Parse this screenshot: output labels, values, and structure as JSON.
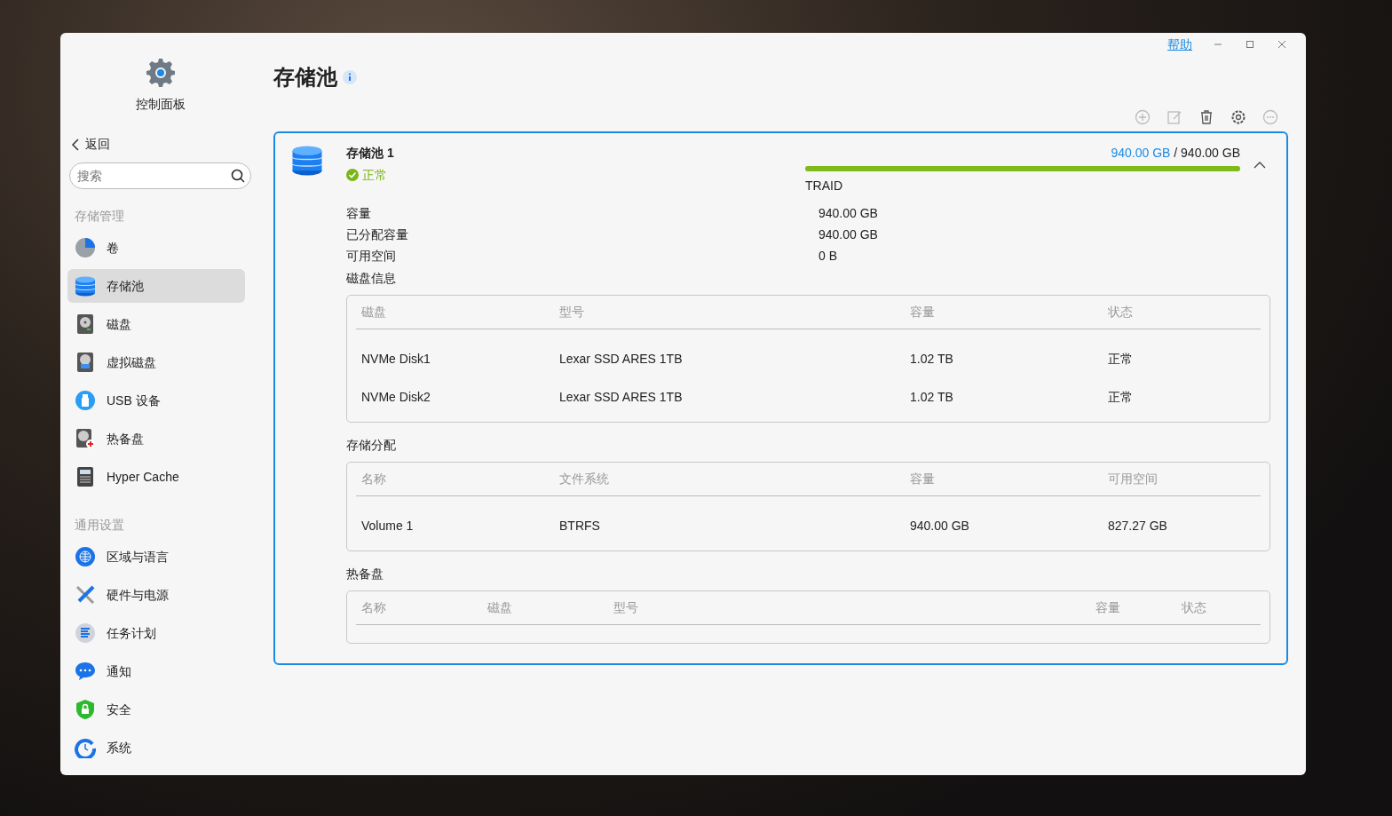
{
  "window": {
    "help_link": "帮助"
  },
  "sidebar": {
    "app_title": "控制面板",
    "back": "返回",
    "search": {
      "placeholder": "搜索"
    },
    "groups": [
      {
        "title": "存储管理",
        "items": [
          {
            "label": "卷",
            "selected": false
          },
          {
            "label": "存储池",
            "selected": true
          },
          {
            "label": "磁盘",
            "selected": false
          },
          {
            "label": "虚拟磁盘",
            "selected": false
          },
          {
            "label": "USB 设备",
            "selected": false
          },
          {
            "label": "热备盘",
            "selected": false
          },
          {
            "label": "Hyper Cache",
            "selected": false
          }
        ]
      },
      {
        "title": "通用设置",
        "items": [
          {
            "label": "区域与语言",
            "selected": false
          },
          {
            "label": "硬件与电源",
            "selected": false
          },
          {
            "label": "任务计划",
            "selected": false
          },
          {
            "label": "通知",
            "selected": false
          },
          {
            "label": "安全",
            "selected": false
          },
          {
            "label": "系统",
            "selected": false
          }
        ]
      }
    ]
  },
  "page_title": "存储池",
  "pool": {
    "name": "存储池 1",
    "status": "正常",
    "used": "940.00 GB",
    "separator": "/",
    "total": "940.00 GB",
    "level": 1.0,
    "raid_type": "TRAID",
    "expanded": true,
    "properties": [
      {
        "label": "容量",
        "value": "940.00 GB"
      },
      {
        "label": "已分配容量",
        "value": "940.00 GB"
      },
      {
        "label": "可用空间",
        "value": "0 B"
      }
    ],
    "sections": [
      {
        "title": "磁盘信息",
        "columns": [
          "磁盘",
          "型号",
          "容量",
          "状态"
        ],
        "rows": [
          [
            "NVMe Disk1",
            "Lexar SSD ARES 1TB",
            "1.02 TB",
            "正常"
          ],
          [
            "NVMe Disk2",
            "Lexar SSD ARES 1TB",
            "1.02 TB",
            "正常"
          ]
        ]
      },
      {
        "title": "存储分配",
        "columns": [
          "名称",
          "文件系统",
          "容量",
          "可用空间"
        ],
        "rows": [
          [
            "Volume 1",
            "BTRFS",
            "940.00 GB",
            "827.27 GB"
          ]
        ]
      },
      {
        "title": "热备盘",
        "columns": [
          "名称",
          "磁盘",
          "型号",
          "容量",
          "状态"
        ]
      }
    ]
  }
}
